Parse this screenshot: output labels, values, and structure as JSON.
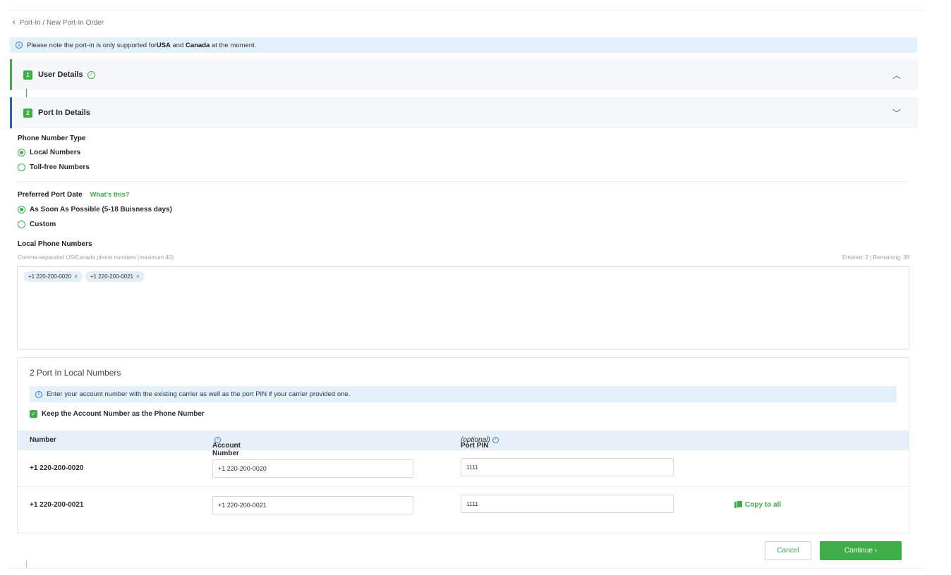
{
  "breadcrumb": {
    "text": "Port-In / New Port-In Order"
  },
  "notice": {
    "prefix": "Please note the port-in is only supported for ",
    "usa": "USA",
    "and": " and ",
    "canada": "Canada",
    "suffix": " at the moment."
  },
  "steps": [
    {
      "number": "1",
      "title": "User Details",
      "status": "complete",
      "expanded": false
    },
    {
      "number": "2",
      "title": "Port In Details",
      "status": "active",
      "expanded": true
    }
  ],
  "phone_type": {
    "label": "Phone Number Type",
    "options": [
      {
        "label": "Local Numbers",
        "selected": true
      },
      {
        "label": "Toll-free Numbers",
        "selected": false
      }
    ]
  },
  "port_date": {
    "label": "Preferred Port Date",
    "help_link": "What's this?",
    "options": [
      {
        "label": "As Soon As Possible (5-18 Buisness days)",
        "selected": true
      },
      {
        "label": "Custom",
        "selected": false
      }
    ]
  },
  "local_numbers": {
    "label": "Local Phone Numbers",
    "helper": "Comma-separated US/Canada phone numbers (maximum 40)",
    "counter": "Entered: 2 | Remaining: 38",
    "chips": [
      "+1 220-200-0020",
      "+1 220-200-0021"
    ]
  },
  "port_card": {
    "title": "2 Port In Local Numbers",
    "note": "Enter your account number with the existing carrier as well as the port PIN if your carrier provided one.",
    "keep_checkbox": {
      "label": "Keep the Account Number as the Phone Number",
      "checked": true
    },
    "columns": {
      "number": "Number",
      "account": "Account Number",
      "pin": "Port PIN",
      "pin_optional": "(optional)"
    },
    "rows": [
      {
        "number": "+1 220-200-0020",
        "account": "+1 220-200-0020",
        "pin": "1111"
      },
      {
        "number": "+1 220-200-0021",
        "account": "+1 220-200-0021",
        "pin": "1111"
      }
    ],
    "copy_all": "Copy to all"
  },
  "actions": {
    "cancel": "Cancel",
    "continue": "Continue"
  },
  "colors": {
    "accent": "#3fae49",
    "info_bg": "#e3f1fb",
    "active_step": "#2d5fb5"
  }
}
